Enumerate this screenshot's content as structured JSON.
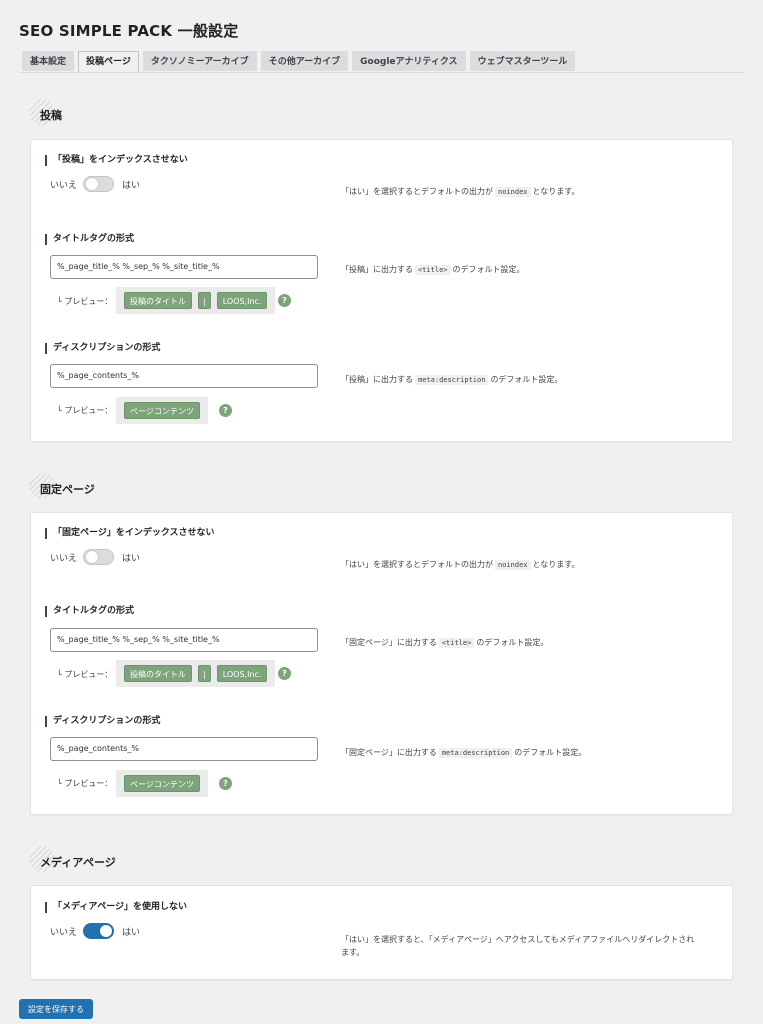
{
  "page": {
    "title": "SEO SIMPLE PACK 一般設定"
  },
  "tabs": [
    {
      "label": "基本設定"
    },
    {
      "label": "投稿ページ"
    },
    {
      "label": "タクソノミーアーカイブ"
    },
    {
      "label": "その他アーカイブ"
    },
    {
      "label": "Googleアナリティクス"
    },
    {
      "label": "ウェブマスターツール"
    }
  ],
  "sections": {
    "post": {
      "heading": "投稿",
      "noindex": {
        "label": "「投稿」をインデックスさせない",
        "off_label": "いいえ",
        "on_label": "はい",
        "enabled": false,
        "desc_pre": "「はい」を選択するとデフォルトの出力が",
        "desc_code": "noindex",
        "desc_post": "となります。"
      },
      "title_format": {
        "label": "タイトルタグの形式",
        "value": "%_page_title_% %_sep_% %_site_title_%",
        "desc_pre": "「投稿」に出力する",
        "desc_code": "<title>",
        "desc_post": "のデフォルト設定。",
        "preview_label": "└ プレビュー：",
        "preview_parts": [
          "投稿のタイトル",
          "|",
          "LOOS,Inc."
        ]
      },
      "description_format": {
        "label": "ディスクリプションの形式",
        "value": "%_page_contents_%",
        "desc_pre": "「投稿」に出力する",
        "desc_code": "meta:description",
        "desc_post": "のデフォルト設定。",
        "preview_label": "└ プレビュー：",
        "preview_parts": [
          "ページコンテンツ"
        ]
      }
    },
    "page": {
      "heading": "固定ページ",
      "noindex": {
        "label": "「固定ページ」をインデックスさせない",
        "off_label": "いいえ",
        "on_label": "はい",
        "enabled": false,
        "desc_pre": "「はい」を選択するとデフォルトの出力が",
        "desc_code": "noindex",
        "desc_post": "となります。"
      },
      "title_format": {
        "label": "タイトルタグの形式",
        "value": "%_page_title_% %_sep_% %_site_title_%",
        "desc_pre": "「固定ページ」に出力する",
        "desc_code": "<title>",
        "desc_post": "のデフォルト設定。",
        "preview_label": "└ プレビュー：",
        "preview_parts": [
          "投稿のタイトル",
          "|",
          "LOOS,Inc."
        ]
      },
      "description_format": {
        "label": "ディスクリプションの形式",
        "value": "%_page_contents_%",
        "desc_pre": "「固定ページ」に出力する",
        "desc_code": "meta:description",
        "desc_post": "のデフォルト設定。",
        "preview_label": "└ プレビュー：",
        "preview_parts": [
          "ページコンテンツ"
        ]
      }
    },
    "media": {
      "heading": "メディアページ",
      "disable": {
        "label": "「メディアページ」を使用しない",
        "off_label": "いいえ",
        "on_label": "はい",
        "enabled": true,
        "desc_line1": "「はい」を選択すると、「メディアページ」へアクセスしてもメディアファイルへリダイレクトされ",
        "desc_line2": "ます。"
      }
    }
  },
  "help_glyph": "?",
  "save_button": {
    "label": "設定を保存する"
  },
  "colors": {
    "accent": "#2271b1",
    "preview_pill": "#7ea47c"
  }
}
